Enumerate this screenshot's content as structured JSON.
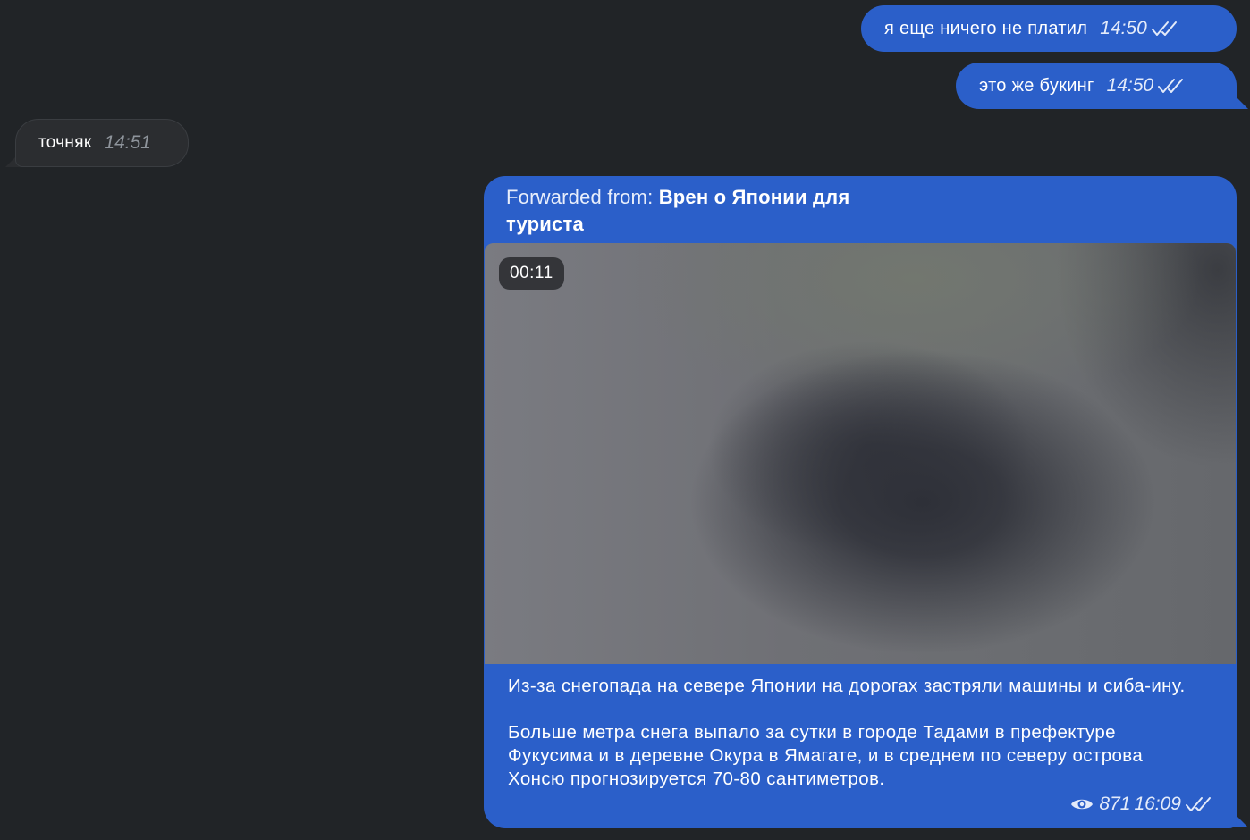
{
  "messages": [
    {
      "direction": "outgoing",
      "text": "я еще ничего не платил",
      "time": "14:50",
      "status_icon": "double-check-icon"
    },
    {
      "direction": "outgoing",
      "text": "это же букинг",
      "time": "14:50",
      "status_icon": "double-check-icon"
    },
    {
      "direction": "incoming",
      "text": "точняк",
      "time": "14:51"
    }
  ],
  "forwarded": {
    "prefix": "Forwarded from:",
    "source": "Врен о Японии для туриста",
    "video_duration": "00:11",
    "caption_paragraph_1": "Из-за снегопада на севере Японии на дорогах застряли машины и сиба-ину.",
    "caption_paragraph_2": "Больше метра снега выпало за сутки в городе Тадами в префектуре Фукусима и в деревне Окура в Ямагате, и в среднем по северу острова Хонсю прогнозируется 70-80 сантиметров.",
    "views": "871",
    "time": "16:09",
    "views_icon": "eye-icon",
    "status_icon": "double-check-icon"
  },
  "colors": {
    "background": "#212427",
    "outgoing_bubble": "#2b5fc9",
    "incoming_bubble": "#2b2d30"
  }
}
